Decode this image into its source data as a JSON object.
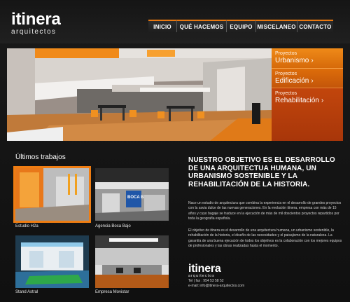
{
  "brand": {
    "name": "itinera",
    "tagline": "arquitectos"
  },
  "nav": [
    {
      "label": "INICIO"
    },
    {
      "label": "QUÉ HACEMOS"
    },
    {
      "label": "EQUIPO"
    },
    {
      "label": "MISCELANEO"
    },
    {
      "label": "CONTACTO"
    }
  ],
  "projects": [
    {
      "kicker": "Proyectos",
      "title": "Urbanismo",
      "arrow": "›"
    },
    {
      "kicker": "Proyectos",
      "title": "Edificación",
      "arrow": "›"
    },
    {
      "kicker": "Proyectos",
      "title": "Rehabilitación",
      "arrow": "›"
    }
  ],
  "latest": {
    "title": "Últimos trabajos",
    "items": [
      {
        "caption": "Estudio H2a"
      },
      {
        "caption": "Agencia Boca Bajo"
      },
      {
        "caption": "Stand Astral"
      },
      {
        "caption": "Empresa Movistar"
      }
    ],
    "thumb_sign": "BOCA BAJO"
  },
  "about": {
    "headline": "NUESTRO OBJETIVO ES EL DESARROLLO DE UNA ARQUITECTUA HUMANA, UN URBANISMO SOSTENIBLE Y LA REHABILITACIÓN DE LA HISTORIA.",
    "paragraph1": "Nace un estudio de arquitectura que combina la experiencia en el desarrollo de grandes proyectos con la savia dulce de las nuevas generaciones. En la evolución itinera, empresa con más de 15 años y cuyo bagaje se traduce en la ejecución de más de mil doscientos proyectos repartidos por toda la geografía española.",
    "paragraph2": "El objetivo de itinera es el desarrollo de una arquitectura humana, un urbanismo sostenible, la rehabilitación de la historia, el diseño de las necesidades y el paisajismo de la naturaleza. La garantía de una buena ejecución de todos los objetivos es la colaboración con los mejores equipos de profesionales y las obras realizadas hasta el momento."
  },
  "contact": {
    "phone": "Tel | fax : 954 53 58 52",
    "email": "e-mail: info@itinera-arquitectos.com"
  },
  "colors": {
    "accent": "#ef7d12",
    "background": "#161616"
  }
}
